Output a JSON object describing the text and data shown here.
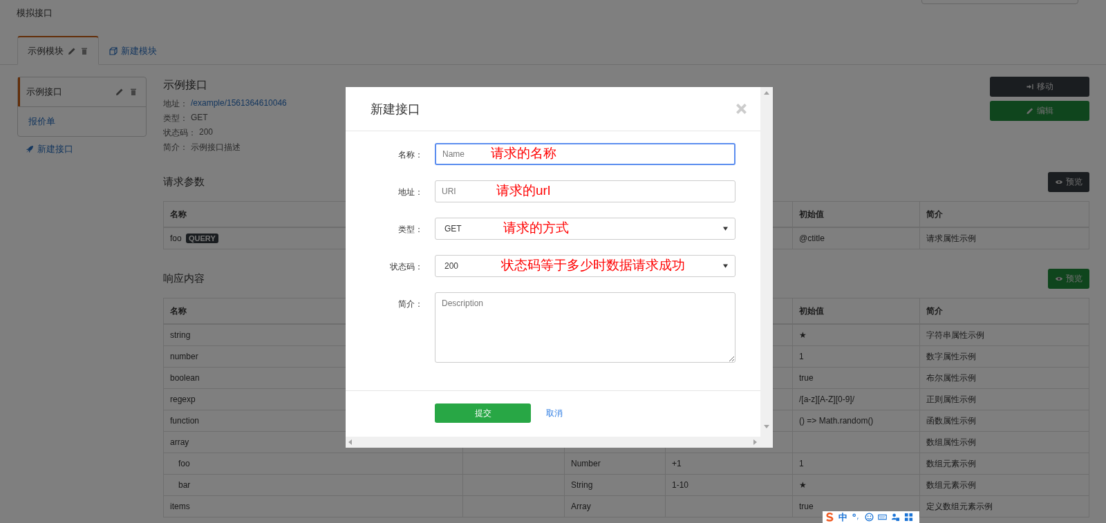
{
  "app_title": "模拟接口",
  "tabs": [
    {
      "label": "示例模块",
      "kind": "module",
      "selected": true
    },
    {
      "label": "新建模块",
      "kind": "add",
      "selected": false
    }
  ],
  "sidebar": {
    "items": [
      {
        "label": "示例接口",
        "selected": true
      },
      {
        "label": "报价单",
        "selected": false
      }
    ],
    "add_link": "新建接口"
  },
  "detail": {
    "title": "示例接口",
    "fields": [
      {
        "label": "地址：",
        "value": "/example/1561364610046",
        "kind": "link"
      },
      {
        "label": "类型：",
        "value": "GET",
        "kind": "text"
      },
      {
        "label": "状态码：",
        "value": "200",
        "kind": "text"
      },
      {
        "label": "简介：",
        "value": "示例接口描述",
        "kind": "text"
      }
    ]
  },
  "actions": [
    {
      "label": "移动",
      "kind": "move"
    },
    {
      "label": "编辑",
      "kind": "edit"
    }
  ],
  "sections": [
    {
      "title": "请求参数",
      "preview": {
        "label": "预览",
        "kind": "dark"
      },
      "columns": [
        "名称",
        null,
        null,
        null,
        "初始值",
        "简介"
      ],
      "rows": [
        {
          "cells": [
            "foo",
            null,
            null,
            null,
            "@ctitle",
            "请求属性示例"
          ],
          "badge": "QUERY"
        }
      ]
    },
    {
      "title": "响应内容",
      "preview": {
        "label": "预览",
        "kind": "green"
      },
      "columns": [
        "名称",
        null,
        null,
        null,
        "初始值",
        "简介"
      ],
      "rows": [
        {
          "cells": [
            "string",
            null,
            null,
            null,
            "★",
            "字符串属性示例"
          ]
        },
        {
          "cells": [
            "number",
            null,
            null,
            null,
            "1",
            "数字属性示例"
          ]
        },
        {
          "cells": [
            "boolean",
            null,
            null,
            null,
            "true",
            "布尔属性示例"
          ]
        },
        {
          "cells": [
            "regexp",
            null,
            null,
            null,
            "/[a-z][A-Z][0-9]/",
            "正则属性示例"
          ]
        },
        {
          "cells": [
            "function",
            null,
            null,
            null,
            "() => Math.random()",
            "函数属性示例"
          ]
        },
        {
          "cells": [
            "array",
            null,
            null,
            null,
            null,
            "数组属性示例"
          ],
          "children": [
            {
              "cells": [
                "foo",
                null,
                "Number",
                "+1",
                "1",
                "数组元素示例"
              ]
            },
            {
              "cells": [
                "bar",
                null,
                "String",
                "1-10",
                "★",
                "数组元素示例"
              ]
            }
          ]
        },
        {
          "cells": [
            "items",
            null,
            "Array",
            null,
            "true",
            "定义数组元素示例"
          ]
        }
      ]
    }
  ],
  "modal": {
    "title": "新建接口",
    "fields": [
      {
        "label": "名称：",
        "kind": "input",
        "placeholder": "Name",
        "focused": true,
        "annotation": "请求的名称"
      },
      {
        "label": "地址：",
        "kind": "input",
        "placeholder": "URI",
        "focused": false,
        "annotation": "请求的url"
      },
      {
        "label": "类型：",
        "kind": "select",
        "value": "GET",
        "focused": false,
        "annotation": "请求的方式"
      },
      {
        "label": "状态码：",
        "kind": "select",
        "value": "200",
        "focused": false,
        "annotation": "状态码等于多少时数据请求成功"
      },
      {
        "label": "简介：",
        "kind": "textarea",
        "placeholder": "Description",
        "focused": false
      }
    ],
    "submit": "提交",
    "cancel": "取消"
  },
  "ime_bar": {
    "mode": "中"
  }
}
